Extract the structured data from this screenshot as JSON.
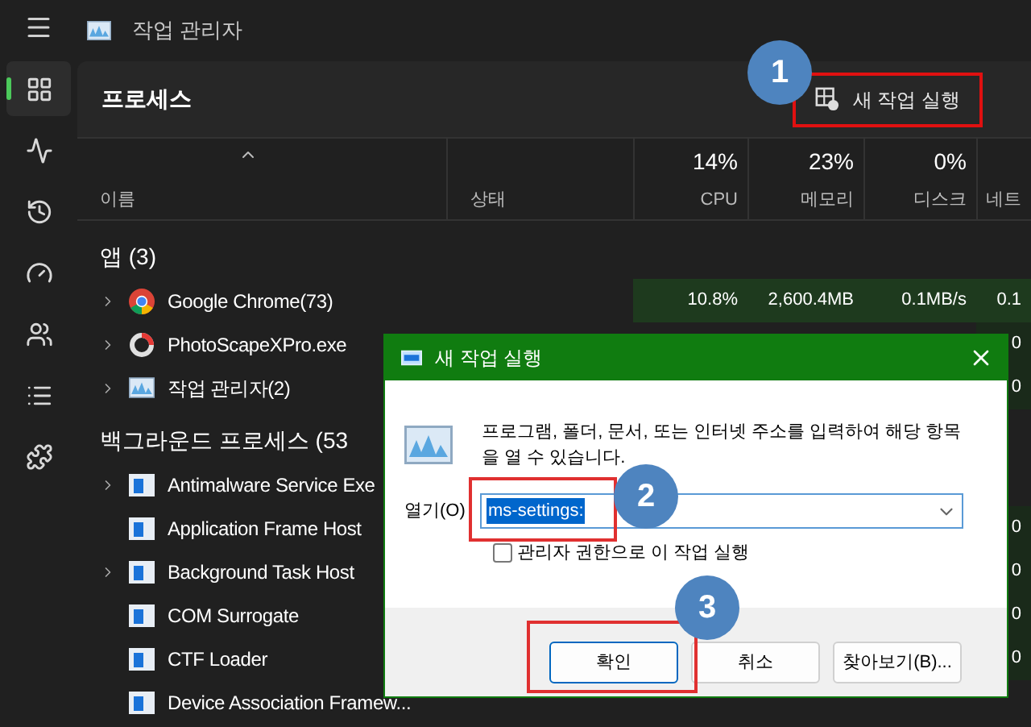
{
  "window": {
    "title": "작업 관리자"
  },
  "sidebar": {
    "items": [
      {
        "kind": "processes",
        "selected": true
      },
      {
        "kind": "performance",
        "selected": false
      },
      {
        "kind": "history",
        "selected": false
      },
      {
        "kind": "startup",
        "selected": false
      },
      {
        "kind": "users",
        "selected": false
      },
      {
        "kind": "details",
        "selected": false
      },
      {
        "kind": "services",
        "selected": false
      }
    ]
  },
  "page": {
    "title": "프로세스",
    "new_task_button": "새 작업 실행"
  },
  "columns": [
    {
      "label": "이름"
    },
    {
      "label": "상태"
    },
    {
      "percent": "14%",
      "label": "CPU"
    },
    {
      "percent": "23%",
      "label": "메모리"
    },
    {
      "percent": "0%",
      "label": "디스크"
    },
    {
      "label": "네트"
    }
  ],
  "groups": [
    {
      "title": "앱 (3)",
      "rows": [
        {
          "name": "Google Chrome(73)",
          "kind": "chrome",
          "expandable": true,
          "cpu": "10.8%",
          "memory": "2,600.4MB",
          "disk": "0.1MB/s",
          "network": "0.1"
        },
        {
          "name": "PhotoScapeXPro.exe",
          "kind": "ring",
          "expandable": true,
          "network": "0"
        },
        {
          "name": "작업 관리자(2)",
          "kind": "monitor",
          "expandable": true,
          "network": "0"
        }
      ]
    },
    {
      "title": "백그라운드 프로세스 (53",
      "rows": [
        {
          "name": "Antimalware Service Exe",
          "kind": "window",
          "expandable": true
        },
        {
          "name": "Application Frame Host",
          "kind": "window",
          "expandable": false,
          "network": "0"
        },
        {
          "name": "Background Task Host",
          "kind": "window",
          "expandable": true,
          "network": "0"
        },
        {
          "name": "COM Surrogate",
          "kind": "window",
          "expandable": false,
          "network": "0"
        },
        {
          "name": "CTF Loader",
          "kind": "window",
          "expandable": false,
          "network": "0"
        },
        {
          "name": "Device Association Framew...",
          "kind": "window",
          "expandable": false
        }
      ]
    }
  ],
  "dialog": {
    "title": "새 작업 실행",
    "message": "프로그램, 폴더, 문서, 또는 인터넷 주소를 입력하여 해당 항목을 열 수 있습니다.",
    "open_label": "열기(O)",
    "value": "ms-settings:",
    "checkbox": {
      "label": "관리자 권한으로 이 작업 실행",
      "checked": false
    },
    "buttons": [
      {
        "label": "확인",
        "focused": true
      },
      {
        "label": "취소",
        "focused": false
      },
      {
        "label": "찾아보기(B)...",
        "focused": false
      }
    ]
  },
  "annotations": [
    {
      "label": "1"
    },
    {
      "label": "2"
    },
    {
      "label": "3"
    }
  ]
}
